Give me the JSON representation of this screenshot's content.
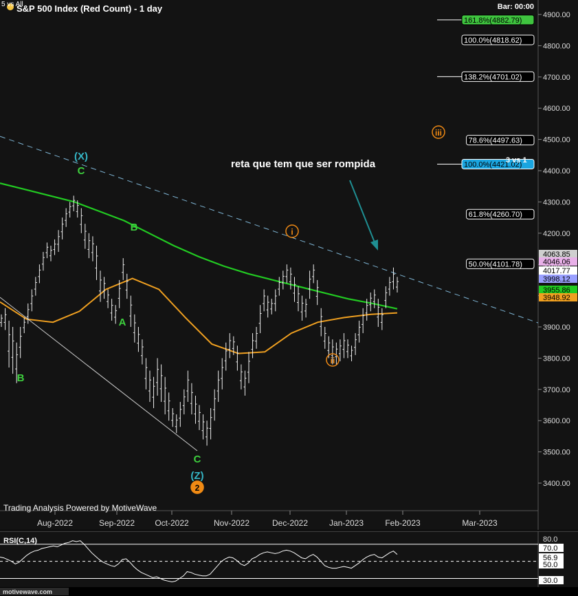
{
  "header": {
    "title": "S&P 500 Index (Red Count) - 1 day",
    "prefix": "5 vs All",
    "bar_label": "Bar: 00:00"
  },
  "footer": {
    "powered_by": "Trading Analysis Powered by MotiveWave",
    "watermark": "motivewave.com"
  },
  "annotation": {
    "text": "reta que tem que ser rompida",
    "wave_note": "3 vs 1"
  },
  "colors": {
    "background": "#131313",
    "price_bars": "#f0f0f0",
    "ma_green": "#22cc22",
    "ma_orange": "#f0a020",
    "trendline_dash": "#7fb6d6",
    "wave_green": "#3ed13e",
    "wave_orange": "#f08a14",
    "wave_cyan": "#35b6c6",
    "arrow": "#1f8f93",
    "fib_highlight_green": "#3fc43f",
    "fib_highlight_blue": "#1aa5e0"
  },
  "chart_data": [
    {
      "type": "ohlc",
      "title": "S&P 500 Index (Red Count) - 1 day",
      "y_axis": {
        "ticks": [
          3400,
          3500,
          3600,
          3700,
          3800,
          3900,
          4000,
          4100,
          4200,
          4300,
          4400,
          4500,
          4600,
          4700,
          4800,
          4900
        ],
        "tick_labels": [
          "3400.00",
          "3500.00",
          "3600.00",
          "3700.00",
          "3800.00",
          "3900.00",
          "4000.00",
          "4100.00",
          "4200.00",
          "4300.00",
          "4400.00",
          "4500.00",
          "4600.00",
          "4700.00",
          "4800.00",
          "4900.00"
        ],
        "ylim": [
          3345,
          4935
        ]
      },
      "x_axis": {
        "labels": [
          "Aug-2022",
          "Sep-2022",
          "Oct-2022",
          "Nov-2022",
          "Dec-2022",
          "Jan-2023",
          "Feb-2023",
          "Mar-2023"
        ]
      },
      "price_labels": [
        {
          "value": "4063.85",
          "color": "#cfcfcf",
          "text_color": "#000000"
        },
        {
          "value": "4046.06",
          "color": "#e8b0e8",
          "text_color": "#000000"
        },
        {
          "value": "4017.77",
          "color": "#ffffff",
          "text_color": "#000000"
        },
        {
          "value": "3998.12",
          "color": "#9aa0ff",
          "text_color": "#000000"
        },
        {
          "value": "3955.86",
          "color": "#22cc22",
          "text_color": "#000000"
        },
        {
          "value": "3948.92",
          "color": "#f0a020",
          "text_color": "#000000"
        }
      ],
      "fib_levels": [
        {
          "label": "161.8%(4882.79)",
          "pct": "161.8%",
          "value": 4882.79,
          "style": "green"
        },
        {
          "label": "100.0%(4818.62)",
          "pct": "100.0%",
          "value": 4818.62,
          "style": "plain"
        },
        {
          "label": "138.2%(4701.02)",
          "pct": "138.2%",
          "value": 4701.02,
          "style": "plain"
        },
        {
          "label": "78.6%(4497.63)",
          "pct": "78.6%",
          "value": 4497.63,
          "style": "plain"
        },
        {
          "label": "100.0%(4421.02)",
          "pct": "100.0%",
          "value": 4421.02,
          "style": "blue"
        },
        {
          "label": "61.8%(4260.70)",
          "pct": "61.8%",
          "value": 4260.7,
          "style": "plain"
        },
        {
          "label": "50.0%(4101.78)",
          "pct": "50.0%",
          "value": 4101.78,
          "style": "plain"
        }
      ],
      "wave_labels": [
        {
          "text": "(X)",
          "color": "cyan",
          "circled": false
        },
        {
          "text": "C",
          "color": "green",
          "circled": false
        },
        {
          "text": "B",
          "color": "green",
          "circled": false
        },
        {
          "text": "A",
          "color": "green",
          "circled": false
        },
        {
          "text": "B",
          "color": "green",
          "circled": false
        },
        {
          "text": "C",
          "color": "green",
          "circled": false
        },
        {
          "text": "(Z)",
          "color": "cyan",
          "circled": false
        },
        {
          "text": "2",
          "color": "orange",
          "circled": true
        },
        {
          "text": "i",
          "color": "orange",
          "circled": true
        },
        {
          "text": "ii",
          "color": "orange",
          "circled": true
        },
        {
          "text": "iii",
          "color": "orange",
          "circled": true
        }
      ],
      "series": [
        {
          "name": "Price (OHLC)",
          "type": "ohlc",
          "points": [
            [
              3940,
              3900
            ],
            [
              3960,
              3890
            ],
            [
              3920,
              3770
            ],
            [
              3900,
              3750
            ],
            [
              3850,
              3720
            ],
            [
              3900,
              3800
            ],
            [
              3930,
              3880
            ],
            [
              3975,
              3910
            ],
            [
              4020,
              3950
            ],
            [
              4060,
              4000
            ],
            [
              4100,
              4040
            ],
            [
              4140,
              4080
            ],
            [
              4170,
              4120
            ],
            [
              4160,
              4110
            ],
            [
              4180,
              4130
            ],
            [
              4210,
              4140
            ],
            [
              4250,
              4180
            ],
            [
              4280,
              4220
            ],
            [
              4300,
              4250
            ],
            [
              4320,
              4270
            ],
            [
              4305,
              4250
            ],
            [
              4280,
              4200
            ],
            [
              4230,
              4150
            ],
            [
              4200,
              4120
            ],
            [
              4190,
              4110
            ],
            [
              4160,
              4050
            ],
            [
              4080,
              3980
            ],
            [
              4060,
              3990
            ],
            [
              4020,
              3960
            ],
            [
              3990,
              3920
            ],
            [
              3970,
              3910
            ],
            [
              4050,
              3960
            ],
            [
              4120,
              4050
            ],
            [
              4070,
              3990
            ],
            [
              4000,
              3900
            ],
            [
              3940,
              3850
            ],
            [
              3900,
              3820
            ],
            [
              3860,
              3780
            ],
            [
              3800,
              3700
            ],
            [
              3760,
              3660
            ],
            [
              3740,
              3640
            ],
            [
              3800,
              3680
            ],
            [
              3780,
              3660
            ],
            [
              3740,
              3620
            ],
            [
              3690,
              3600
            ],
            [
              3640,
              3580
            ],
            [
              3620,
              3560
            ],
            [
              3660,
              3580
            ],
            [
              3700,
              3620
            ],
            [
              3760,
              3660
            ],
            [
              3720,
              3620
            ],
            [
              3680,
              3590
            ],
            [
              3650,
              3570
            ],
            [
              3620,
              3540
            ],
            [
              3600,
              3520
            ],
            [
              3640,
              3540
            ],
            [
              3700,
              3600
            ],
            [
              3760,
              3660
            ],
            [
              3800,
              3700
            ],
            [
              3850,
              3760
            ],
            [
              3880,
              3800
            ],
            [
              3870,
              3810
            ],
            [
              3840,
              3760
            ],
            [
              3780,
              3700
            ],
            [
              3760,
              3680
            ],
            [
              3820,
              3720
            ],
            [
              3880,
              3800
            ],
            [
              3900,
              3830
            ],
            [
              3970,
              3880
            ],
            [
              4020,
              3950
            ],
            [
              4000,
              3930
            ],
            [
              3990,
              3940
            ],
            [
              4020,
              3950
            ],
            [
              4060,
              4000
            ],
            [
              4080,
              4020
            ],
            [
              4100,
              4040
            ],
            [
              4090,
              4020
            ],
            [
              4060,
              3980
            ],
            [
              4030,
              3950
            ],
            [
              4000,
              3920
            ],
            [
              3990,
              3930
            ],
            [
              4080,
              3990
            ],
            [
              4100,
              4040
            ],
            [
              4050,
              3970
            ],
            [
              3960,
              3870
            ],
            [
              3900,
              3830
            ],
            [
              3870,
              3800
            ],
            [
              3860,
              3780
            ],
            [
              3850,
              3780
            ],
            [
              3860,
              3790
            ],
            [
              3880,
              3800
            ],
            [
              3860,
              3800
            ],
            [
              3840,
              3790
            ],
            [
              3880,
              3810
            ],
            [
              3920,
              3850
            ],
            [
              3960,
              3880
            ],
            [
              3990,
              3920
            ],
            [
              4010,
              3950
            ],
            [
              4020,
              3960
            ],
            [
              3990,
              3900
            ],
            [
              3960,
              3890
            ],
            [
              4030,
              3960
            ],
            [
              4060,
              4000
            ],
            [
              4090,
              4020
            ],
            [
              4060,
              4010
            ]
          ]
        },
        {
          "name": "MA green",
          "type": "line",
          "values": [
            4360,
            4340,
            4320,
            4300,
            4270,
            4240,
            4200,
            4160,
            4125,
            4095,
            4070,
            4050,
            4030,
            4010,
            3990,
            3975,
            3958
          ]
        },
        {
          "name": "MA orange",
          "type": "line",
          "values": [
            3980,
            3925,
            3915,
            3950,
            4020,
            4055,
            4020,
            3930,
            3845,
            3815,
            3820,
            3880,
            3915,
            3930,
            3940,
            3945
          ]
        },
        {
          "name": "Trendline",
          "type": "line",
          "values": [
            4510,
            4155,
            3913
          ]
        }
      ]
    },
    {
      "type": "line",
      "title": "RSI(C,14)",
      "y_axis": {
        "tick_labels": [
          "80.0",
          "70.0",
          "56.9",
          "50.0",
          "30.0"
        ],
        "ylim": [
          20,
          85
        ]
      },
      "series": [
        {
          "name": "RSI(C,14)",
          "values": [
            55,
            54,
            52,
            50,
            47,
            49,
            53,
            57,
            60,
            62,
            63,
            65,
            66,
            67,
            68,
            67,
            69,
            71,
            72,
            74,
            73,
            74,
            70,
            65,
            60,
            56,
            52,
            49,
            47,
            45,
            44,
            47,
            52,
            53,
            49,
            44,
            40,
            37,
            35,
            33,
            31,
            32,
            30,
            28,
            27,
            26,
            27,
            30,
            33,
            38,
            37,
            35,
            34,
            33,
            33,
            35,
            40,
            45,
            50,
            53,
            55,
            54,
            51,
            47,
            45,
            48,
            53,
            55,
            58,
            60,
            61,
            60,
            59,
            60,
            62,
            63,
            62,
            60,
            57,
            54,
            53,
            56,
            58,
            55,
            50,
            45,
            43,
            42,
            42,
            43,
            44,
            43,
            42,
            45,
            48,
            52,
            55,
            57,
            58,
            55,
            54,
            57,
            60,
            62,
            58
          ]
        }
      ]
    }
  ]
}
